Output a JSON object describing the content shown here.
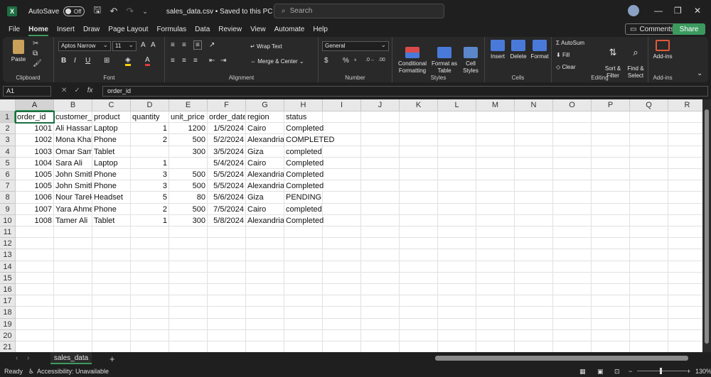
{
  "titlebar": {
    "autosave_label": "AutoSave",
    "autosave_state": "Off",
    "doc_title": "sales_data.csv • Saved to this PC ⌄",
    "search_placeholder": "Search"
  },
  "menu": [
    "File",
    "Home",
    "Insert",
    "Draw",
    "Page Layout",
    "Formulas",
    "Data",
    "Review",
    "View",
    "Automate",
    "Help"
  ],
  "buttons": {
    "comments": "Comments",
    "share": "Share"
  },
  "ribbon": {
    "clipboard": {
      "label": "Clipboard",
      "paste": "Paste"
    },
    "font": {
      "label": "Font",
      "family": "Aptos Narrow",
      "size": "11"
    },
    "alignment": {
      "label": "Alignment",
      "wrap": "Wrap Text",
      "merge": "Merge & Center"
    },
    "number": {
      "label": "Number",
      "format": "General"
    },
    "styles": {
      "label": "Styles",
      "cond": "Conditional\nFormatting",
      "table": "Format as\nTable",
      "cell": "Cell\nStyles"
    },
    "cells": {
      "label": "Cells",
      "insert": "Insert",
      "delete": "Delete",
      "format": "Format"
    },
    "editing": {
      "label": "Editing",
      "autosum": "AutoSum",
      "fill": "Fill",
      "clear": "Clear",
      "sort": "Sort &\nFilter",
      "find": "Find &\nSelect"
    },
    "addins": {
      "label": "Add-ins",
      "btn": "Add-ins"
    }
  },
  "formula_bar": {
    "name_box": "A1",
    "content": "order_id"
  },
  "columns": [
    "A",
    "B",
    "C",
    "D",
    "E",
    "F",
    "G",
    "H",
    "I",
    "J",
    "K",
    "L",
    "M",
    "N",
    "O",
    "P",
    "Q",
    "R"
  ],
  "rows": [
    [
      "order_id",
      "customer_name",
      "product",
      "quantity",
      "unit_price",
      "order_date",
      "region",
      "status"
    ],
    [
      "1001",
      "Ali Hassan",
      "Laptop",
      "1",
      "1200",
      "1/5/2024",
      "Cairo",
      "Completed"
    ],
    [
      "1002",
      "Mona Khaled",
      "Phone",
      "2",
      "500",
      "5/2/2024",
      "Alexandria",
      "COMPLETED"
    ],
    [
      "1003",
      "Omar Samir",
      "Tablet",
      "",
      "300",
      "3/5/2024",
      "Giza",
      "completed"
    ],
    [
      "1004",
      "Sara Ali",
      "Laptop",
      "1",
      "",
      "5/4/2024",
      "Cairo",
      "Completed"
    ],
    [
      "1005",
      "John Smith",
      "Phone",
      "3",
      "500",
      "5/5/2024",
      "Alexandria",
      "Completed"
    ],
    [
      "1005",
      "John Smith",
      "Phone",
      "3",
      "500",
      "5/5/2024",
      "Alexandria",
      "Completed"
    ],
    [
      "1006",
      "Nour Tarek",
      "Headset",
      "5",
      "80",
      "5/6/2024",
      "Giza",
      "PENDING"
    ],
    [
      "1007",
      "Yara Ahmed",
      "Phone",
      "2",
      "500",
      "7/5/2024",
      "Cairo",
      "completed"
    ],
    [
      "1008",
      "Tamer Ali",
      "Tablet",
      "1",
      "300",
      "5/8/2024",
      "Alexandria",
      "Completed"
    ]
  ],
  "row_count": 21,
  "sheet_tab": "sales_data",
  "status": {
    "ready": "Ready",
    "accessibility": "Accessibility: Unavailable",
    "zoom": "130%"
  }
}
